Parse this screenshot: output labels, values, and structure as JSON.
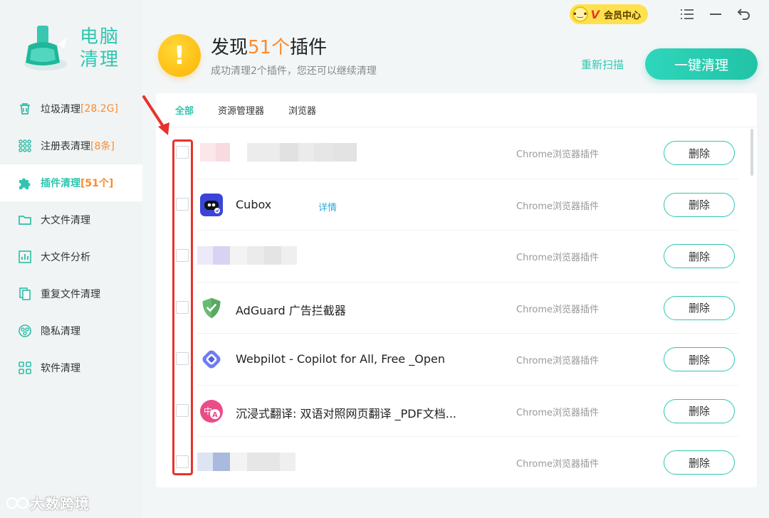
{
  "app": {
    "logo_text_line1": "电脑",
    "logo_text_line2": "清理"
  },
  "sidebar": {
    "items": [
      {
        "label": "垃圾清理",
        "badge": "[28.2G]",
        "icon": "trash-icon",
        "active": false
      },
      {
        "label": "注册表清理",
        "badge": "[8条]",
        "icon": "registry-grid-icon",
        "active": false
      },
      {
        "label": "插件清理",
        "badge": "[51个]",
        "icon": "puzzle-icon",
        "active": true
      },
      {
        "label": "大文件清理",
        "badge": "",
        "icon": "folder-icon",
        "active": false
      },
      {
        "label": "大文件分析",
        "badge": "",
        "icon": "chart-icon",
        "active": false
      },
      {
        "label": "重复文件清理",
        "badge": "",
        "icon": "duplicate-icon",
        "active": false
      },
      {
        "label": "隐私清理",
        "badge": "",
        "icon": "privacy-icon",
        "active": false
      },
      {
        "label": "软件清理",
        "badge": "",
        "icon": "apps-icon",
        "active": false
      }
    ]
  },
  "topbar": {
    "vip_label": "会员中心",
    "vip_letter": "V"
  },
  "header": {
    "title_prefix": "发现",
    "title_count": "51个",
    "title_suffix": "插件",
    "subtitle": "成功清理2个插件，您还可以继续清理",
    "rescan_label": "重新扫描",
    "clean_label": "一键清理"
  },
  "tabs": [
    {
      "label": "全部",
      "active": true
    },
    {
      "label": "资源管理器",
      "active": false
    },
    {
      "label": "浏览器",
      "active": false
    }
  ],
  "extensions": [
    {
      "name": "",
      "blurred": true,
      "detail": "",
      "type": "Chrome浏览器插件",
      "delete_label": "删除"
    },
    {
      "name": "Cubox",
      "blurred": false,
      "icon": "cubox-icon",
      "detail": "详情",
      "type": "Chrome浏览器插件",
      "delete_label": "删除"
    },
    {
      "name": "",
      "blurred": true,
      "detail": "",
      "type": "Chrome浏览器插件",
      "delete_label": "删除"
    },
    {
      "name": "AdGuard 广告拦截器",
      "blurred": false,
      "icon": "adguard-icon",
      "detail": "",
      "type": "Chrome浏览器插件",
      "delete_label": "删除"
    },
    {
      "name": "Webpilot - Copilot for All, Free _Open",
      "blurred": false,
      "icon": "webpilot-icon",
      "detail": "",
      "type": "Chrome浏览器插件",
      "delete_label": "删除"
    },
    {
      "name": "沉浸式翻译: 双语对照网页翻译 _PDF文档...",
      "blurred": false,
      "icon": "immersive-translate-icon",
      "detail": "",
      "type": "Chrome浏览器插件",
      "delete_label": "删除"
    },
    {
      "name": "",
      "blurred": true,
      "detail": "",
      "type": "Chrome浏览器插件",
      "delete_label": "删除"
    }
  ],
  "watermark": "大数跨境",
  "colors": {
    "accent": "#2fc6b0",
    "highlight": "#e8322c",
    "count": "#ff8a2b"
  }
}
